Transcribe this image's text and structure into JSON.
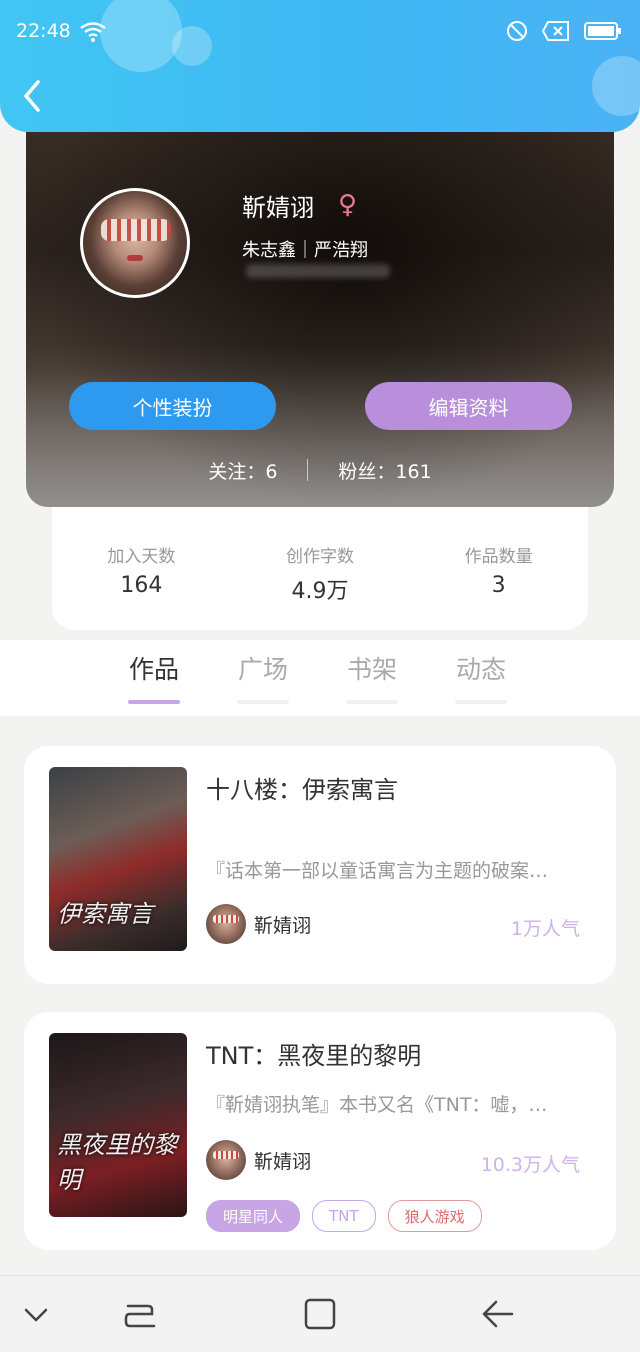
{
  "status_bar": {
    "time": "22:48"
  },
  "header": {
    "back_icon": "chevron-left-icon"
  },
  "profile": {
    "name": "靳婧诩",
    "gender_icon": "female-icon",
    "gender_color": "#e67b8f",
    "bias": "朱志鑫｜严浩翔",
    "style_button": "个性装扮",
    "edit_button": "编辑资料",
    "following": "关注：6",
    "fans": "粉丝：161"
  },
  "stats": [
    {
      "label": "加入天数",
      "value": "164"
    },
    {
      "label": "创作字数",
      "value": "4.9万"
    },
    {
      "label": "作品数量",
      "value": "3"
    }
  ],
  "tabs": [
    {
      "label": "作品",
      "active": true
    },
    {
      "label": "广场",
      "active": false
    },
    {
      "label": "书架",
      "active": false
    },
    {
      "label": "动态",
      "active": false
    }
  ],
  "books": [
    {
      "title": "十八楼：伊索寓言",
      "cover_text": "伊索寓言",
      "description": "『话本第一部以童话寓言为主题的破案…",
      "author": "靳婧诩",
      "popularity": "1万人气",
      "tags": []
    },
    {
      "title": "TNT：黑夜里的黎明",
      "cover_text": "黑夜里的黎明",
      "description": "『靳婧诩执笔』本书又名《TNT：嘘，…",
      "author": "靳婧诩",
      "popularity": "10.3万人气",
      "tags": [
        "明星同人",
        "TNT",
        "狼人游戏"
      ]
    }
  ],
  "colors": {
    "accent_blue": "#2d9af0",
    "accent_purple": "#b98fdc",
    "header_blue": "#41c6f3",
    "tag_red": "#e06b6b"
  },
  "navbar": [
    "chevron-down-icon",
    "recent-apps-icon",
    "home-square-icon",
    "back-arrow-icon"
  ]
}
